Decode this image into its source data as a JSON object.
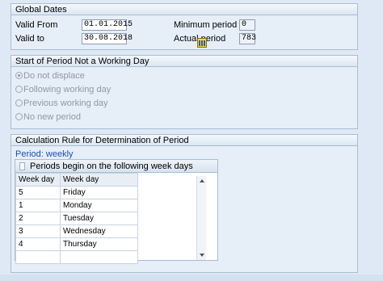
{
  "global_dates": {
    "title": "Global Dates",
    "valid_from_label": "Valid From",
    "valid_from_value": "01.01.2015",
    "valid_to_label": "Valid to",
    "valid_to_value": "30.08.2018",
    "min_period_label": "Minimum period",
    "min_period_value": "0",
    "actual_period_label": "Actual period",
    "actual_period_value": "783"
  },
  "start_period": {
    "title": "Start of Period Not a Working Day",
    "options": [
      {
        "label": "Do not displace",
        "selected": true
      },
      {
        "label": "Following working day",
        "selected": false
      },
      {
        "label": "Previous working day",
        "selected": false
      },
      {
        "label": "No new period",
        "selected": false
      }
    ]
  },
  "calc_rule": {
    "title": "Calculation Rule for Determination of Period",
    "period_text": "Period: weekly",
    "table_title": "Periods begin on the following week days",
    "columns": [
      "Week day",
      "Week day"
    ],
    "rows": [
      [
        "5",
        "Friday"
      ],
      [
        "1",
        "Monday"
      ],
      [
        "2",
        "Tuesday"
      ],
      [
        "3",
        "Wednesday"
      ],
      [
        "4",
        "Thursday"
      ],
      [
        "",
        ""
      ]
    ],
    "settings_icon": "table-settings-icon"
  },
  "colors": {
    "background": "#dfe9f5",
    "group_border": "#a9bdd3",
    "link": "#1b4fb3",
    "disabled_text": "#8e99a6"
  }
}
